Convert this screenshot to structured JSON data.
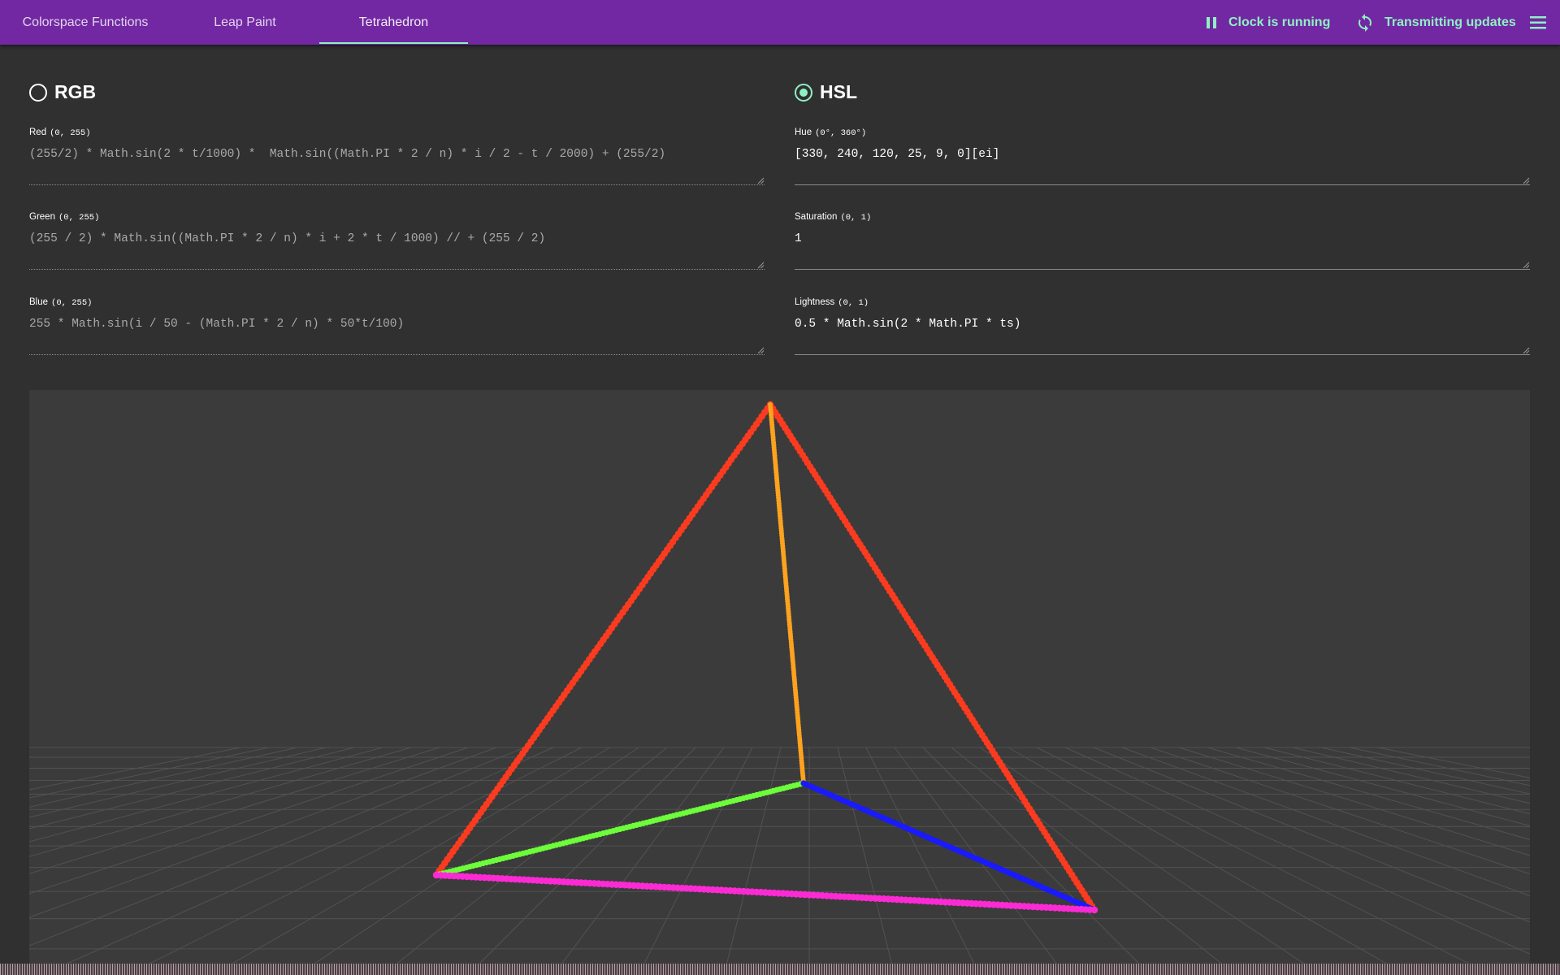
{
  "tabs": [
    {
      "label": "Colorspace Functions",
      "active": false
    },
    {
      "label": "Leap Paint",
      "active": false
    },
    {
      "label": "Tetrahedron",
      "active": true
    }
  ],
  "actions": {
    "clock_label": "Clock is running",
    "transmit_label": "Transmitting updates"
  },
  "modes": {
    "rgb": {
      "label": "RGB",
      "selected": false
    },
    "hsl": {
      "label": "HSL",
      "selected": true
    }
  },
  "rgb_fields": [
    {
      "label": "Red",
      "range": "(0, 255)",
      "value": "(255/2) * Math.sin(2 * t/1000) *  Math.sin((Math.PI * 2 / n) * i / 2 - t / 2000) + (255/2)"
    },
    {
      "label": "Green",
      "range": "(0, 255)",
      "value": "(255 / 2) * Math.sin((Math.PI * 2 / n) * i + 2 * t / 1000) // + (255 / 2)"
    },
    {
      "label": "Blue",
      "range": "(0, 255)",
      "value": "255 * Math.sin(i / 50 - (Math.PI * 2 / n) * 50*t/100)"
    }
  ],
  "hsl_fields": [
    {
      "label": "Hue",
      "range": "(0°, 360°)",
      "value": "[330, 240, 120, 25, 9, 0][ei]"
    },
    {
      "label": "Saturation",
      "range": "(0, 1)",
      "value": "1"
    },
    {
      "label": "Lightness",
      "range": "(0, 1)",
      "value": "0.5 * Math.sin(2 * Math.PI * ts)"
    }
  ],
  "tetrahedron": {
    "edges": [
      {
        "name": "apex-left",
        "color": "#ff3b1f"
      },
      {
        "name": "apex-right",
        "color": "#ff3b1f"
      },
      {
        "name": "apex-center",
        "color": "#ffa21f"
      },
      {
        "name": "left-center",
        "color": "#6dff3a"
      },
      {
        "name": "center-right",
        "color": "#1a1aff"
      },
      {
        "name": "left-right",
        "color": "#ff2ad4"
      }
    ]
  },
  "colors": {
    "app_bar": "#7228a2",
    "accent": "#8ff0c4",
    "background": "#303030",
    "viewport": "#3b3b3b"
  }
}
